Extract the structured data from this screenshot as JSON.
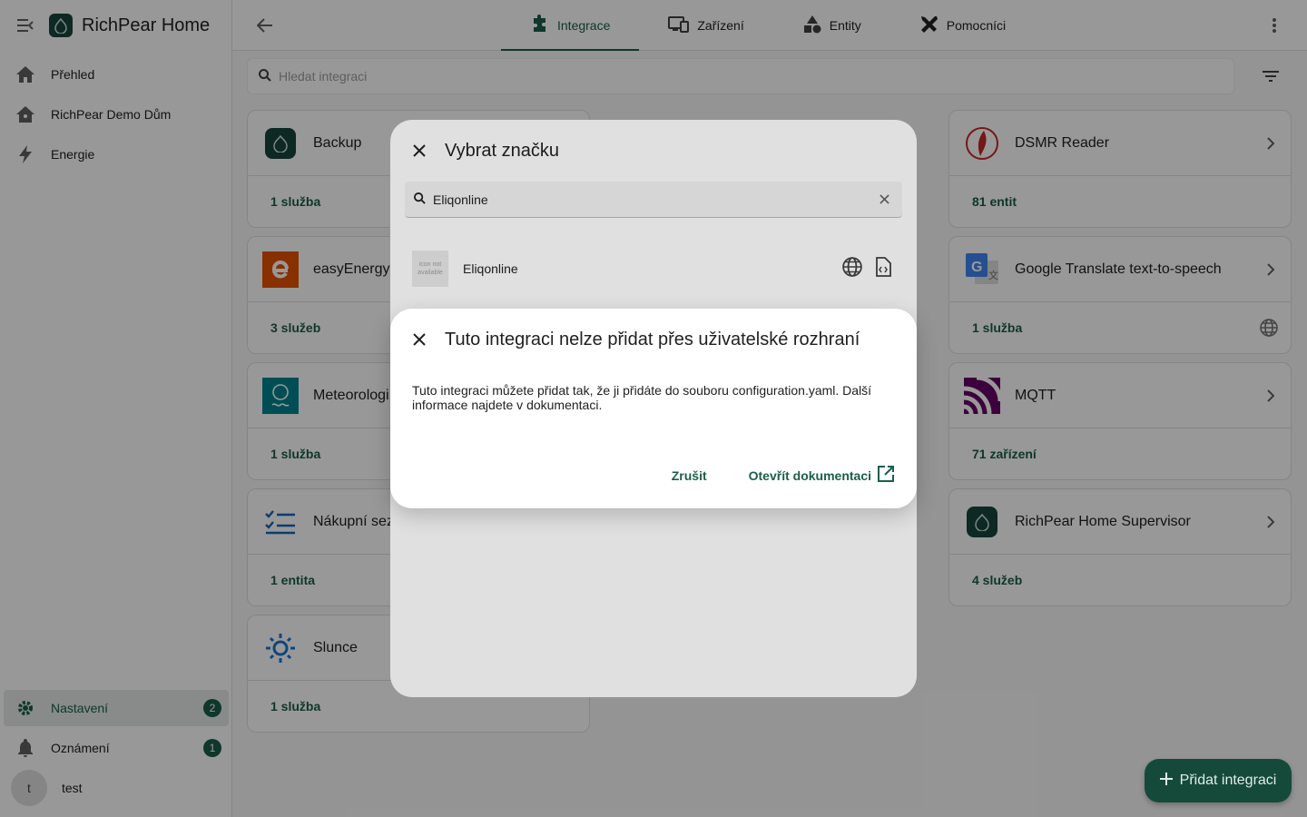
{
  "app": {
    "title": "RichPear Home"
  },
  "sidebar": {
    "items": [
      {
        "label": "Přehled"
      },
      {
        "label": "RichPear Demo Dům"
      },
      {
        "label": "Energie"
      }
    ],
    "bottom": {
      "settings": {
        "label": "Nastavení",
        "badge": "2"
      },
      "notifications": {
        "label": "Oznámení",
        "badge": "1"
      },
      "user": {
        "initial": "t",
        "name": "test"
      }
    }
  },
  "tabs": [
    {
      "label": "Integrace",
      "active": true
    },
    {
      "label": "Zařízení"
    },
    {
      "label": "Entity"
    },
    {
      "label": "Pomocníci"
    }
  ],
  "search": {
    "placeholder": "Hledat integraci"
  },
  "cards": [
    {
      "title": "Backup",
      "footer": "1 služba",
      "icon": "richpear-logo"
    },
    {
      "title": "DSMR Reader",
      "footer": "81 entit",
      "icon": "dsmr-icon"
    },
    {
      "title": "easyEnergy",
      "footer": "3 služeb",
      "icon": "easyenergy-icon"
    },
    {
      "title": "Google Translate text-to-speech",
      "footer": "1 služba",
      "icon": "google-translate-icon"
    },
    {
      "title": "Meteorologi",
      "footer": "1 služba",
      "icon": "met-icon"
    },
    {
      "title": "MQTT",
      "footer": "71 zařízení",
      "icon": "mqtt-icon"
    },
    {
      "title": "Nákupní sez",
      "footer": "1 entita",
      "icon": "shopping-list-icon"
    },
    {
      "title": "RichPear Home Supervisor",
      "footer": "4 služeb",
      "icon": "richpear-logo"
    },
    {
      "title": "Slunce",
      "footer": "1 služba",
      "icon": "sun-icon"
    }
  ],
  "brand_dialog": {
    "title": "Vybrat značku",
    "search_value": "Eliqonline",
    "result": {
      "name": "Eliqonline",
      "icon_text": "icon not available"
    }
  },
  "alert_dialog": {
    "title": "Tuto integraci nelze přidat přes uživatelské rozhraní",
    "body": "Tuto integraci můžete přidat tak, že ji přidáte do souboru configuration.yaml. Další informace najdete v dokumentaci.",
    "cancel": "Zrušit",
    "open_docs": "Otevřít dokumentaci"
  },
  "fab": {
    "label": "Přidat integraci"
  },
  "colors": {
    "primary": "#1b5e4a",
    "fab": "#154a3b"
  }
}
